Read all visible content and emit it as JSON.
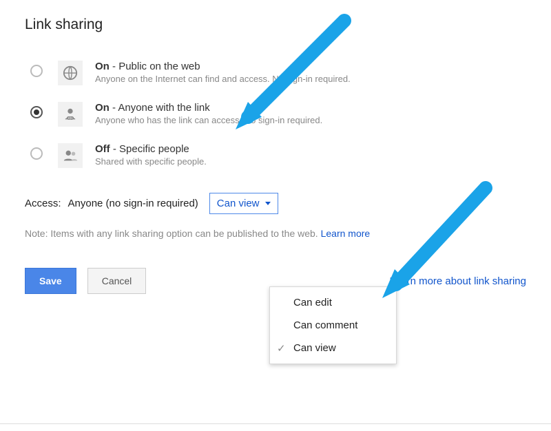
{
  "title": "Link sharing",
  "options": [
    {
      "status": "On",
      "label": "Public on the web",
      "sub": "Anyone on the Internet can find and access. No sign-in required.",
      "icon": "globe",
      "selected": false
    },
    {
      "status": "On",
      "label": "Anyone with the link",
      "sub": "Anyone who has the link can access. No sign-in required.",
      "icon": "person-link",
      "selected": true
    },
    {
      "status": "Off",
      "label": "Specific people",
      "sub": "Shared with specific people.",
      "icon": "people",
      "selected": false
    }
  ],
  "access": {
    "label": "Access:",
    "who": "Anyone (no sign-in required)",
    "selected": "Can view"
  },
  "dropdown_items": [
    {
      "label": "Can edit",
      "checked": false
    },
    {
      "label": "Can comment",
      "checked": false
    },
    {
      "label": "Can view",
      "checked": true
    }
  ],
  "note": {
    "prefix": "Note: Items with any link sharing option can be published to the web. ",
    "learn_more": "Learn more"
  },
  "buttons": {
    "save": "Save",
    "cancel": "Cancel"
  },
  "about_link": "Learn more about link sharing"
}
